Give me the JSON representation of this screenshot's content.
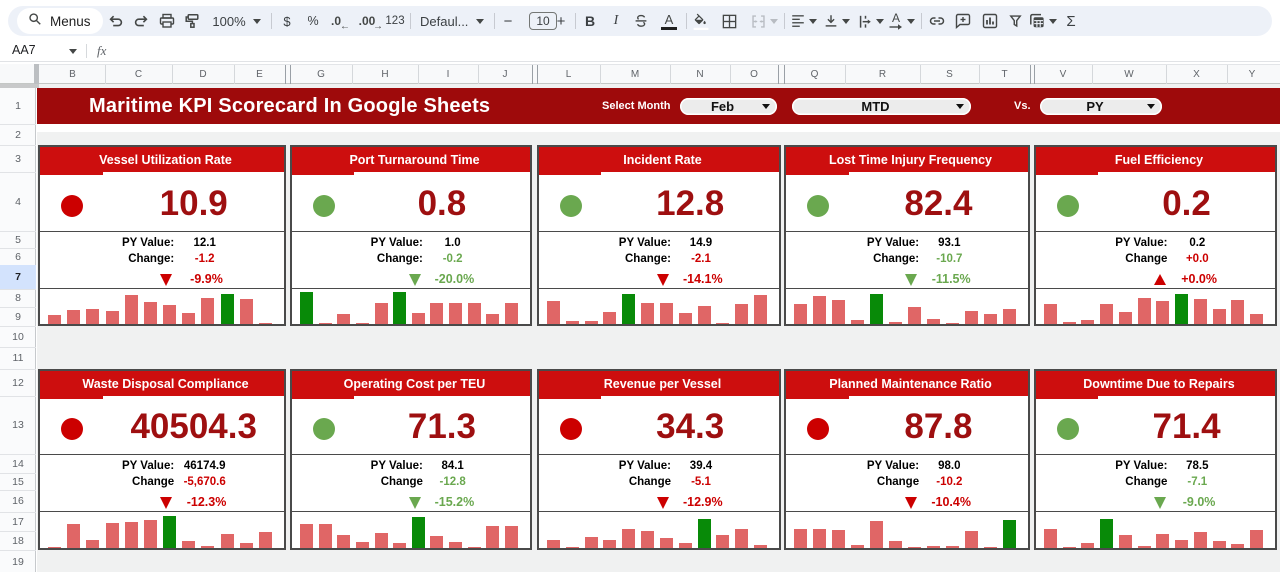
{
  "colors": {
    "band_red": "#9e0a0b",
    "card_red": "#cd0e0e",
    "dark_red": "#9e0f10",
    "neg_red": "#cc0000",
    "pos_green": "#6aa84f",
    "spark_pink": "#e06666",
    "spark_green": "#088a08",
    "selected_row_bg": "#d3e3fd"
  },
  "toolbar": {
    "menus_label": "Menus",
    "zoom_value": "100%",
    "currency": "$",
    "percent": "%",
    "decrease_decimal": ".0",
    "decrease_decimal_arrow": "←",
    "increase_decimal": ".00",
    "increase_decimal_arrow": "→",
    "more_formats": "123",
    "font_name": "Defaul...",
    "minus": "−",
    "font_size": "10",
    "plus": "+",
    "bold": "B",
    "italic": "I",
    "strikethrough": "S",
    "text_color": "A",
    "text_rotation": "A",
    "functions": "Σ"
  },
  "formula_bar": {
    "cell_ref": "AA7",
    "fx": "fx"
  },
  "grid": {
    "columns": [
      "B",
      "C",
      "D",
      "E",
      "G",
      "H",
      "I",
      "J",
      "L",
      "M",
      "N",
      "O",
      "Q",
      "R",
      "S",
      "T",
      "V",
      "W",
      "X",
      "Y"
    ],
    "rows": [
      "1",
      "2",
      "3",
      "4",
      "5",
      "6",
      "7",
      "8",
      "9",
      "10",
      "11",
      "12",
      "13",
      "14",
      "15",
      "16",
      "17",
      "18",
      "19"
    ],
    "selected_row": "7"
  },
  "header_band": {
    "title": "Maritime KPI Scorecard In Google Sheets",
    "select_month_label": "Select Month",
    "month": "Feb",
    "period": "MTD",
    "vs_label": "Vs.",
    "compare": "PY"
  },
  "chart_data": [
    {
      "type": "bar",
      "title": "Vessel Utilization Rate",
      "values": [
        0.28,
        0.42,
        0.44,
        0.4,
        0.88,
        0.68,
        0.58,
        0.32,
        0.78,
        0.92,
        0.76,
        0.03
      ],
      "highlight_index": 9
    },
    {
      "type": "bar",
      "title": "Port Turnaround Time",
      "values": [
        0.97,
        0.03,
        0.3,
        0.03,
        0.63,
        0.97,
        0.32,
        0.63,
        0.63,
        0.63,
        0.3,
        0.63
      ],
      "highlight_index": 5
    },
    {
      "type": "bar",
      "title": "Incident Rate",
      "values": [
        0.7,
        0.08,
        0.09,
        0.35,
        0.92,
        0.65,
        0.65,
        0.33,
        0.55,
        0.03,
        0.6,
        0.88
      ],
      "highlight_index": 4
    },
    {
      "type": "bar",
      "title": "Lost Time Injury Frequency",
      "values": [
        0.6,
        0.85,
        0.72,
        0.13,
        0.9,
        0.06,
        0.52,
        0.15,
        0.03,
        0.4,
        0.3,
        0.45
      ],
      "highlight_index": 4
    },
    {
      "type": "bar",
      "title": "Fuel Efficiency",
      "values": [
        0.6,
        0.05,
        0.12,
        0.6,
        0.37,
        0.8,
        0.7,
        0.92,
        0.75,
        0.45,
        0.73,
        0.3
      ],
      "highlight_index": 7
    },
    {
      "type": "bar",
      "title": "Waste Disposal Compliance",
      "values": [
        0.03,
        0.72,
        0.23,
        0.73,
        0.77,
        0.83,
        0.93,
        0.22,
        0.06,
        0.42,
        0.15,
        0.46
      ],
      "highlight_index": 6
    },
    {
      "type": "bar",
      "title": "Operating Cost per TEU",
      "values": [
        0.72,
        0.7,
        0.37,
        0.18,
        0.45,
        0.15,
        0.9,
        0.35,
        0.17,
        0.03,
        0.65,
        0.65
      ],
      "highlight_index": 6
    },
    {
      "type": "bar",
      "title": "Revenue per Vessel",
      "values": [
        0.25,
        0.03,
        0.32,
        0.24,
        0.57,
        0.5,
        0.3,
        0.15,
        0.85,
        0.38,
        0.55,
        0.1
      ],
      "highlight_index": 8
    },
    {
      "type": "bar",
      "title": "Planned Maintenance Ratio",
      "values": [
        0.55,
        0.57,
        0.52,
        0.1,
        0.8,
        0.22,
        0.02,
        0.07,
        0.06,
        0.5,
        0.02,
        0.83
      ],
      "highlight_index": 11
    },
    {
      "type": "bar",
      "title": "Downtime Due to Repairs",
      "values": [
        0.55,
        0.04,
        0.15,
        0.85,
        0.38,
        0.05,
        0.42,
        0.25,
        0.48,
        0.2,
        0.12,
        0.52
      ],
      "highlight_index": 3
    }
  ],
  "cards": [
    {
      "title": "Vessel Utilization Rate",
      "dot": "red",
      "value": "10.9",
      "py_label": "PY Value:",
      "py_value": "12.1",
      "change_label": "Change:",
      "change_value": "-1.2",
      "change_color": "red",
      "arrow": "down",
      "arrow_color": "red",
      "pct": "-9.9%",
      "pct_color": "red",
      "spark": [
        {
          "v": 0.28
        },
        {
          "v": 0.42
        },
        {
          "v": 0.44
        },
        {
          "v": 0.4
        },
        {
          "v": 0.88
        },
        {
          "v": 0.68
        },
        {
          "v": 0.58
        },
        {
          "v": 0.32
        },
        {
          "v": 0.78
        },
        {
          "v": 0.92,
          "green": true
        },
        {
          "v": 0.76
        },
        {
          "v": 0.03
        }
      ]
    },
    {
      "title": "Port Turnaround Time",
      "dot": "green",
      "value": "0.8",
      "py_label": "PY Value:",
      "py_value": "1.0",
      "change_label": "Change:",
      "change_value": "-0.2",
      "change_color": "green",
      "arrow": "down",
      "arrow_color": "green",
      "pct": "-20.0%",
      "pct_color": "green",
      "spark": [
        {
          "v": 0.97,
          "green": true
        },
        {
          "v": 0.03
        },
        {
          "v": 0.3
        },
        {
          "v": 0.03
        },
        {
          "v": 0.63
        },
        {
          "v": 0.97,
          "green": true
        },
        {
          "v": 0.32
        },
        {
          "v": 0.63
        },
        {
          "v": 0.63
        },
        {
          "v": 0.63
        },
        {
          "v": 0.3
        },
        {
          "v": 0.63
        }
      ]
    },
    {
      "title": "Incident Rate",
      "dot": "green",
      "value": "12.8",
      "py_label": "PY Value:",
      "py_value": "14.9",
      "change_label": "Change:",
      "change_value": "-2.1",
      "change_color": "red",
      "arrow": "down",
      "arrow_color": "red",
      "pct": "-14.1%",
      "pct_color": "red",
      "spark": [
        {
          "v": 0.7
        },
        {
          "v": 0.08
        },
        {
          "v": 0.09
        },
        {
          "v": 0.35
        },
        {
          "v": 0.92,
          "green": true
        },
        {
          "v": 0.65
        },
        {
          "v": 0.65
        },
        {
          "v": 0.33
        },
        {
          "v": 0.55
        },
        {
          "v": 0.03
        },
        {
          "v": 0.6
        },
        {
          "v": 0.88
        }
      ]
    },
    {
      "title": "Lost Time Injury Frequency",
      "dot": "green",
      "value": "82.4",
      "py_label": "PY Value:",
      "py_value": "93.1",
      "change_label": "Change:",
      "change_value": "-10.7",
      "change_color": "green",
      "arrow": "down",
      "arrow_color": "green",
      "pct": "-11.5%",
      "pct_color": "green",
      "spark": [
        {
          "v": 0.6
        },
        {
          "v": 0.85
        },
        {
          "v": 0.72
        },
        {
          "v": 0.13
        },
        {
          "v": 0.9,
          "green": true
        },
        {
          "v": 0.06
        },
        {
          "v": 0.52
        },
        {
          "v": 0.15
        },
        {
          "v": 0.03
        },
        {
          "v": 0.4
        },
        {
          "v": 0.3
        },
        {
          "v": 0.45
        }
      ]
    },
    {
      "title": "Fuel Efficiency",
      "dot": "green",
      "value": "0.2",
      "py_label": "PY Value:",
      "py_value": "0.2",
      "change_label": "Change",
      "change_value": "+0.0",
      "change_color": "red",
      "arrow": "up",
      "arrow_color": "red",
      "pct": "+0.0%",
      "pct_color": "red",
      "spark": [
        {
          "v": 0.6
        },
        {
          "v": 0.05
        },
        {
          "v": 0.12
        },
        {
          "v": 0.6
        },
        {
          "v": 0.37
        },
        {
          "v": 0.8
        },
        {
          "v": 0.7
        },
        {
          "v": 0.92,
          "green": true
        },
        {
          "v": 0.75
        },
        {
          "v": 0.45
        },
        {
          "v": 0.73
        },
        {
          "v": 0.3
        }
      ]
    },
    {
      "title": "Waste Disposal Compliance",
      "dot": "red",
      "value": "40504.3",
      "py_label": "PY Value:",
      "py_value": "46174.9",
      "change_label": "Change",
      "change_value": "-5,670.6",
      "change_color": "red",
      "arrow": "down",
      "arrow_color": "red",
      "pct": "-12.3%",
      "pct_color": "red",
      "spark": [
        {
          "v": 0.03
        },
        {
          "v": 0.72
        },
        {
          "v": 0.23
        },
        {
          "v": 0.73
        },
        {
          "v": 0.77
        },
        {
          "v": 0.83
        },
        {
          "v": 0.93,
          "green": true
        },
        {
          "v": 0.22
        },
        {
          "v": 0.06
        },
        {
          "v": 0.42
        },
        {
          "v": 0.15
        },
        {
          "v": 0.46
        }
      ]
    },
    {
      "title": "Operating Cost per TEU",
      "dot": "green",
      "value": "71.3",
      "py_label": "PY Value:",
      "py_value": "84.1",
      "change_label": "Change",
      "change_value": "-12.8",
      "change_color": "green",
      "arrow": "down",
      "arrow_color": "green",
      "pct": "-15.2%",
      "pct_color": "green",
      "spark": [
        {
          "v": 0.72
        },
        {
          "v": 0.7
        },
        {
          "v": 0.37
        },
        {
          "v": 0.18
        },
        {
          "v": 0.45
        },
        {
          "v": 0.15
        },
        {
          "v": 0.9,
          "green": true
        },
        {
          "v": 0.35
        },
        {
          "v": 0.17
        },
        {
          "v": 0.03
        },
        {
          "v": 0.65
        },
        {
          "v": 0.65
        }
      ]
    },
    {
      "title": "Revenue per Vessel",
      "dot": "red",
      "value": "34.3",
      "py_label": "PY Value:",
      "py_value": "39.4",
      "change_label": "Change",
      "change_value": "-5.1",
      "change_color": "red",
      "arrow": "down",
      "arrow_color": "red",
      "pct": "-12.9%",
      "pct_color": "red",
      "spark": [
        {
          "v": 0.25
        },
        {
          "v": 0.03
        },
        {
          "v": 0.32
        },
        {
          "v": 0.24
        },
        {
          "v": 0.57
        },
        {
          "v": 0.5
        },
        {
          "v": 0.3
        },
        {
          "v": 0.15
        },
        {
          "v": 0.85,
          "green": true
        },
        {
          "v": 0.38
        },
        {
          "v": 0.55
        },
        {
          "v": 0.1
        }
      ]
    },
    {
      "title": "Planned Maintenance Ratio",
      "dot": "red",
      "value": "87.8",
      "py_label": "PY Value:",
      "py_value": "98.0",
      "change_label": "Change",
      "change_value": "-10.2",
      "change_color": "red",
      "arrow": "down",
      "arrow_color": "red",
      "pct": "-10.4%",
      "pct_color": "red",
      "spark": [
        {
          "v": 0.55
        },
        {
          "v": 0.57
        },
        {
          "v": 0.52
        },
        {
          "v": 0.1
        },
        {
          "v": 0.8
        },
        {
          "v": 0.22
        },
        {
          "v": 0.02
        },
        {
          "v": 0.07
        },
        {
          "v": 0.06
        },
        {
          "v": 0.5
        },
        {
          "v": 0.02
        },
        {
          "v": 0.83,
          "green": true
        }
      ]
    },
    {
      "title": "Downtime Due to Repairs",
      "dot": "green",
      "value": "71.4",
      "py_label": "PY Value:",
      "py_value": "78.5",
      "change_label": "Change",
      "change_value": "-7.1",
      "change_color": "green",
      "arrow": "down",
      "arrow_color": "green",
      "pct": "-9.0%",
      "pct_color": "green",
      "spark": [
        {
          "v": 0.55
        },
        {
          "v": 0.04
        },
        {
          "v": 0.15
        },
        {
          "v": 0.85,
          "green": true
        },
        {
          "v": 0.38
        },
        {
          "v": 0.05
        },
        {
          "v": 0.42
        },
        {
          "v": 0.25
        },
        {
          "v": 0.48
        },
        {
          "v": 0.2
        },
        {
          "v": 0.12
        },
        {
          "v": 0.52
        }
      ]
    }
  ]
}
